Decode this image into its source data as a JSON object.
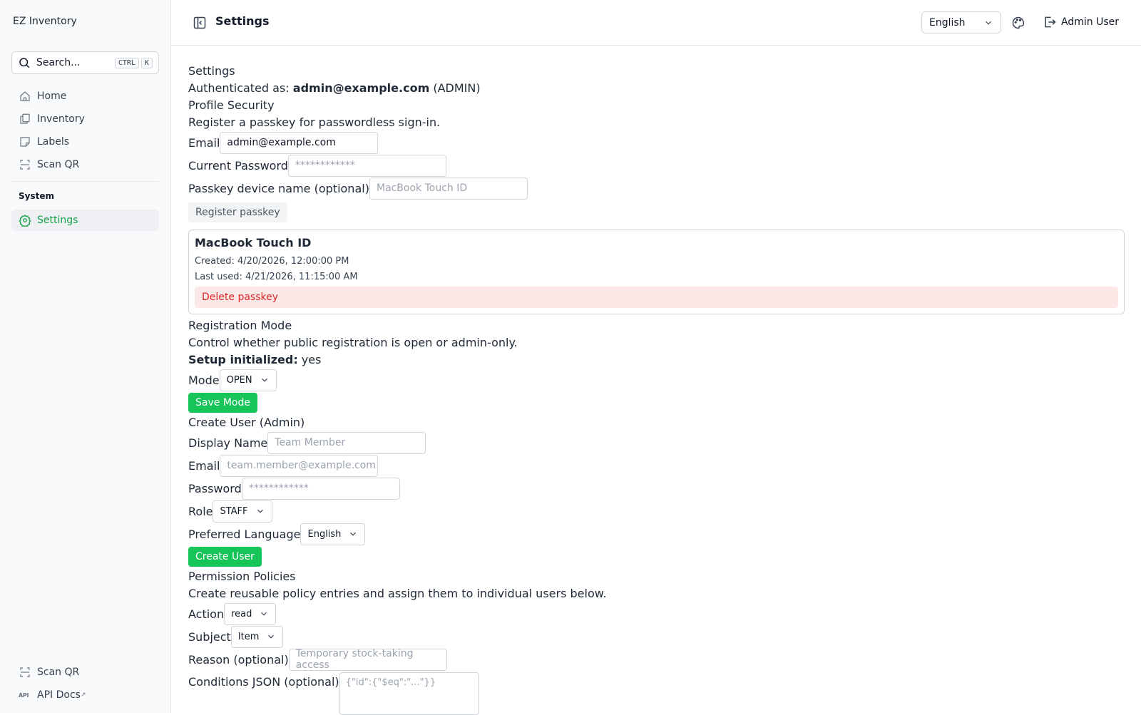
{
  "app": {
    "name": "EZ Inventory"
  },
  "search": {
    "placeholder": "Search...",
    "shortcut_1": "CTRL",
    "shortcut_2": "K"
  },
  "sidebar": {
    "items": [
      {
        "label": "Home",
        "icon": "home-icon"
      },
      {
        "label": "Inventory",
        "icon": "inventory-icon"
      },
      {
        "label": "Labels",
        "icon": "label-icon"
      },
      {
        "label": "Scan QR",
        "icon": "scan-qr-icon"
      }
    ],
    "section_title": "System",
    "system_items": [
      {
        "label": "Settings",
        "icon": "gear-icon",
        "active": true
      }
    ],
    "footer_items": [
      {
        "label": "Scan QR",
        "icon": "scan-qr-icon"
      },
      {
        "label": "API Docs",
        "icon": "api-icon",
        "badge": "API"
      }
    ]
  },
  "header": {
    "title": "Settings",
    "language": "English",
    "user": "Admin User"
  },
  "settings": {
    "heading": "Settings",
    "auth_prefix": "Authenticated as: ",
    "auth_email": "admin@example.com",
    "auth_role": " (ADMIN)"
  },
  "profile_security": {
    "heading": "Profile Security",
    "description": "Register a passkey for passwordless sign-in.",
    "email_label": "Email",
    "email_value": "admin@example.com",
    "password_label": "Current Password",
    "password_placeholder": "************",
    "device_label": "Passkey device name (optional)",
    "device_placeholder": "MacBook Touch ID",
    "register_button": "Register passkey"
  },
  "passkey": {
    "name": "MacBook Touch ID",
    "created": "Created: 4/20/2026, 12:00:00 PM",
    "last_used": "Last used: 4/21/2026, 11:15:00 AM",
    "delete_button": "Delete passkey"
  },
  "registration": {
    "heading": "Registration Mode",
    "description": "Control whether public registration is open or admin-only.",
    "setup_label": "Setup initialized:",
    "setup_value": " yes",
    "mode_label": "Mode",
    "mode_value": "OPEN",
    "save_button": "Save Mode"
  },
  "create_user": {
    "heading": "Create User (Admin)",
    "display_name_label": "Display Name",
    "display_name_placeholder": "Team Member",
    "email_label": "Email",
    "email_placeholder": "team.member@example.com",
    "password_label": "Password",
    "password_placeholder": "************",
    "role_label": "Role",
    "role_value": "STAFF",
    "language_label": "Preferred Language",
    "language_value": "English",
    "create_button": "Create User"
  },
  "permissions": {
    "heading": "Permission Policies",
    "description": "Create reusable policy entries and assign them to individual users below.",
    "action_label": "Action",
    "action_value": "read",
    "subject_label": "Subject",
    "subject_value": "Item",
    "reason_label": "Reason (optional)",
    "reason_placeholder": "Temporary stock-taking access",
    "conditions_label": "Conditions JSON (optional)",
    "conditions_placeholder": "{\"id\":{\"$eq\":\"...\"}}"
  },
  "colors": {
    "accent": "#16c45a",
    "danger": "#dc2626",
    "danger_bg": "#fde8e8",
    "active_nav": "#16a34a"
  }
}
